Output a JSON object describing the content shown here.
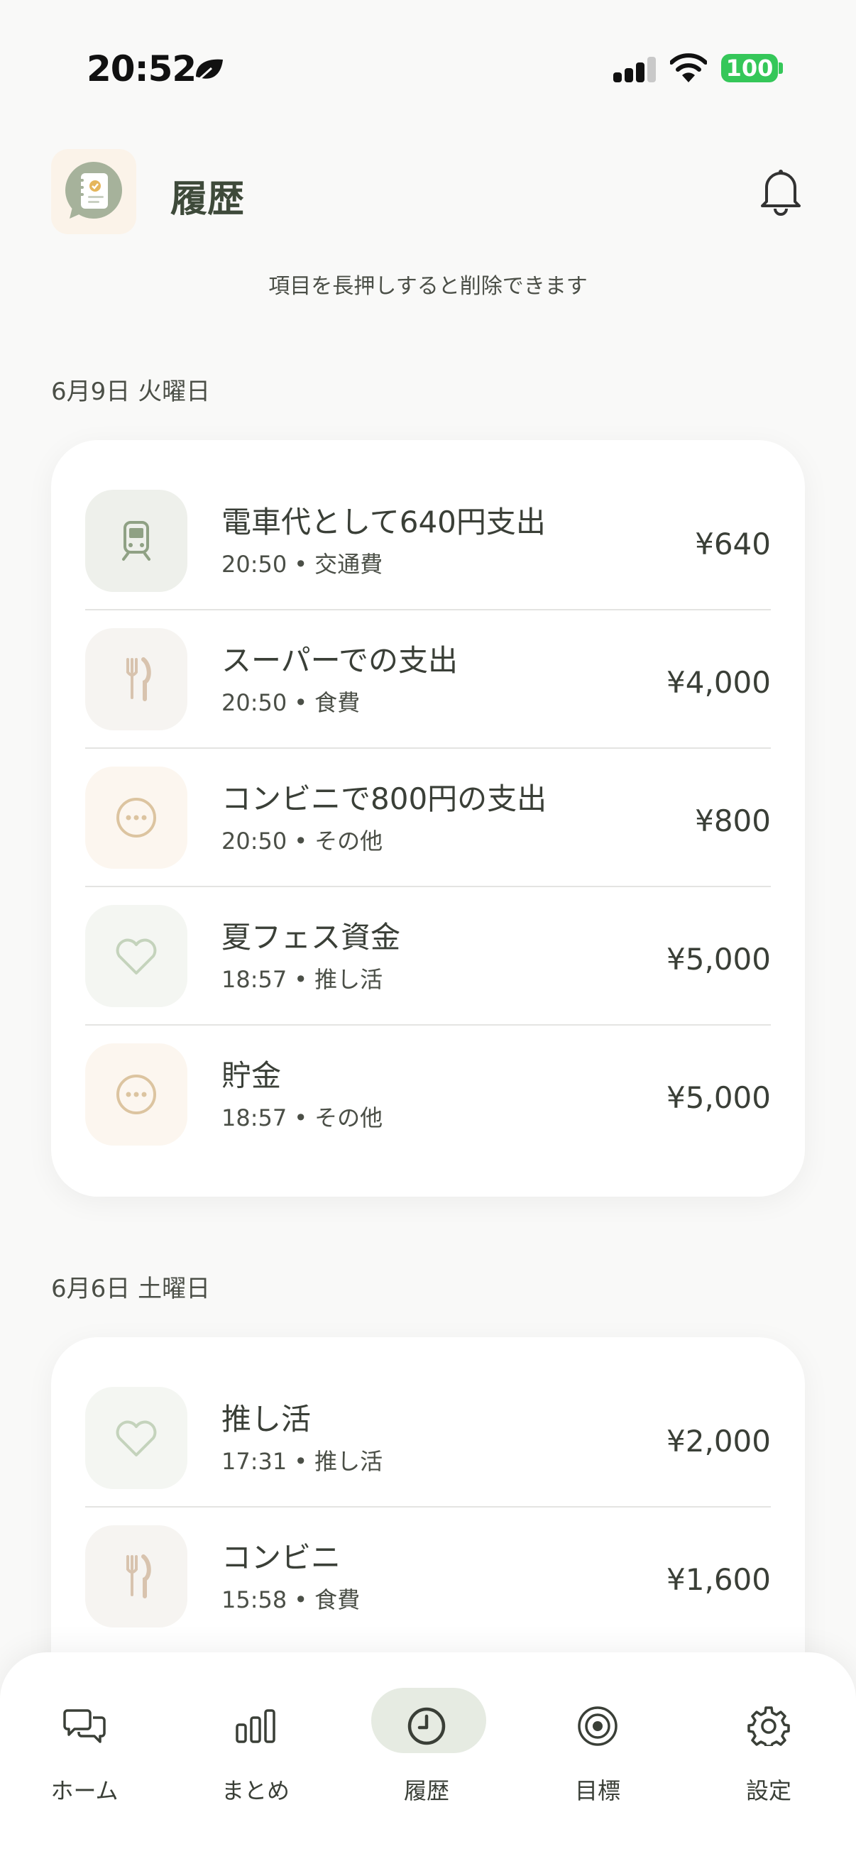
{
  "status_bar": {
    "time": "20:52",
    "battery": "100"
  },
  "header": {
    "title": "履歴"
  },
  "hint": "項目を長押しすると削除できます",
  "groups": [
    {
      "date": "6月9日 火曜日",
      "items": [
        {
          "title": "電車代として640円支出",
          "time": "20:50",
          "category": "交通費",
          "amount": "¥640",
          "icon": "train-icon"
        },
        {
          "title": "スーパーでの支出",
          "time": "20:50",
          "category": "食費",
          "amount": "¥4,000",
          "icon": "fork-knife-icon"
        },
        {
          "title": "コンビニで800円の支出",
          "time": "20:50",
          "category": "その他",
          "amount": "¥800",
          "icon": "more-dots-icon"
        },
        {
          "title": "夏フェス資金",
          "time": "18:57",
          "category": "推し活",
          "amount": "¥5,000",
          "icon": "heart-icon"
        },
        {
          "title": "貯金",
          "time": "18:57",
          "category": "その他",
          "amount": "¥5,000",
          "icon": "more-dots-icon"
        }
      ]
    },
    {
      "date": "6月6日 土曜日",
      "items": [
        {
          "title": "推し活",
          "time": "17:31",
          "category": "推し活",
          "amount": "¥2,000",
          "icon": "heart-icon"
        },
        {
          "title": "コンビニ",
          "time": "15:58",
          "category": "食費",
          "amount": "¥1,600",
          "icon": "fork-knife-icon"
        }
      ]
    }
  ],
  "separator": "•",
  "tabs": [
    {
      "label": "ホーム",
      "icon": "chat-bubbles-icon",
      "active": false
    },
    {
      "label": "まとめ",
      "icon": "bar-chart-icon",
      "active": false
    },
    {
      "label": "履歴",
      "icon": "clock-icon",
      "active": true
    },
    {
      "label": "目標",
      "icon": "target-icon",
      "active": false
    },
    {
      "label": "設定",
      "icon": "gear-icon",
      "active": false
    }
  ],
  "colors": {
    "accent_green": "#8fa184",
    "food_beige": "#d8c3ae",
    "other_tan": "#dcc4a0",
    "heart_green": "#c4d3bc",
    "battery_green": "#35c759"
  }
}
